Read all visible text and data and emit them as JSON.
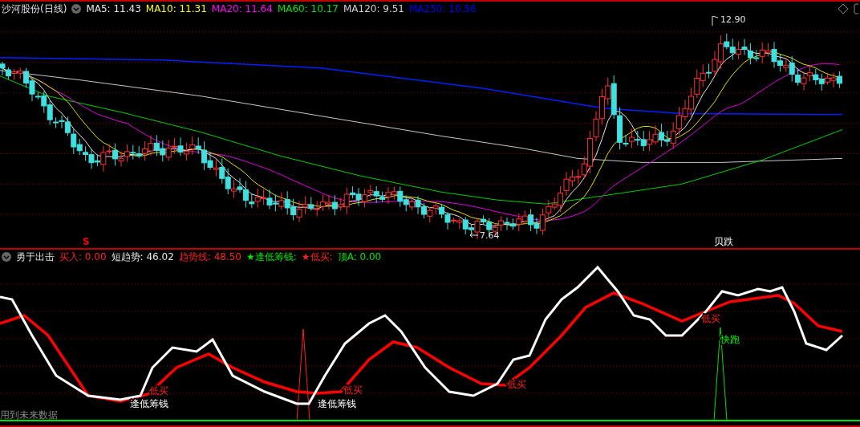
{
  "top_panel": {
    "title": "沙河股份(日线)",
    "moving_averages": [
      {
        "text": "MA5: 11.43",
        "color": "#e6e6e6"
      },
      {
        "text": "MA10: 11.31",
        "color": "#ffff00"
      },
      {
        "text": "MA20: 11.64",
        "color": "#ff00ff"
      },
      {
        "text": "MA60: 10.17",
        "color": "#00e600"
      },
      {
        "text": "MA120: 9.51",
        "color": "#d0d0d0"
      },
      {
        "text": "MA250: 10.56",
        "color": "#0000ff"
      }
    ],
    "markers": [
      {
        "kind": "high",
        "text": "12.90"
      },
      {
        "kind": "low",
        "text": "7.64"
      },
      {
        "kind": "signal",
        "text": "S"
      },
      {
        "kind": "tag",
        "text": "贝跌"
      }
    ]
  },
  "bottom_panel": {
    "title": "勇于出击",
    "indicators": [
      {
        "text": "买入: 0.00",
        "color": "#ff2020"
      },
      {
        "text": "短趋势: 46.02",
        "color": "#e6e6e6"
      },
      {
        "text": "趋势线: 48.50",
        "color": "#ff2020"
      },
      {
        "text": "★逢低筹钱:",
        "color": "#00e600"
      },
      {
        "text": "★低买:",
        "color": "#ff2020"
      },
      {
        "text": "顶A: 0.00",
        "color": "#00e600"
      }
    ],
    "markers": [
      {
        "kind": "buy",
        "text": "低买"
      },
      {
        "kind": "gather",
        "text": "逢低筹钱"
      },
      {
        "kind": "buy",
        "text": "低买"
      },
      {
        "kind": "gather",
        "text": "逢低筹钱"
      },
      {
        "kind": "buy",
        "text": "低买"
      },
      {
        "kind": "buy",
        "text": "低买"
      },
      {
        "kind": "run",
        "text": "快跑"
      }
    ],
    "note": "用到未来数据"
  }
}
